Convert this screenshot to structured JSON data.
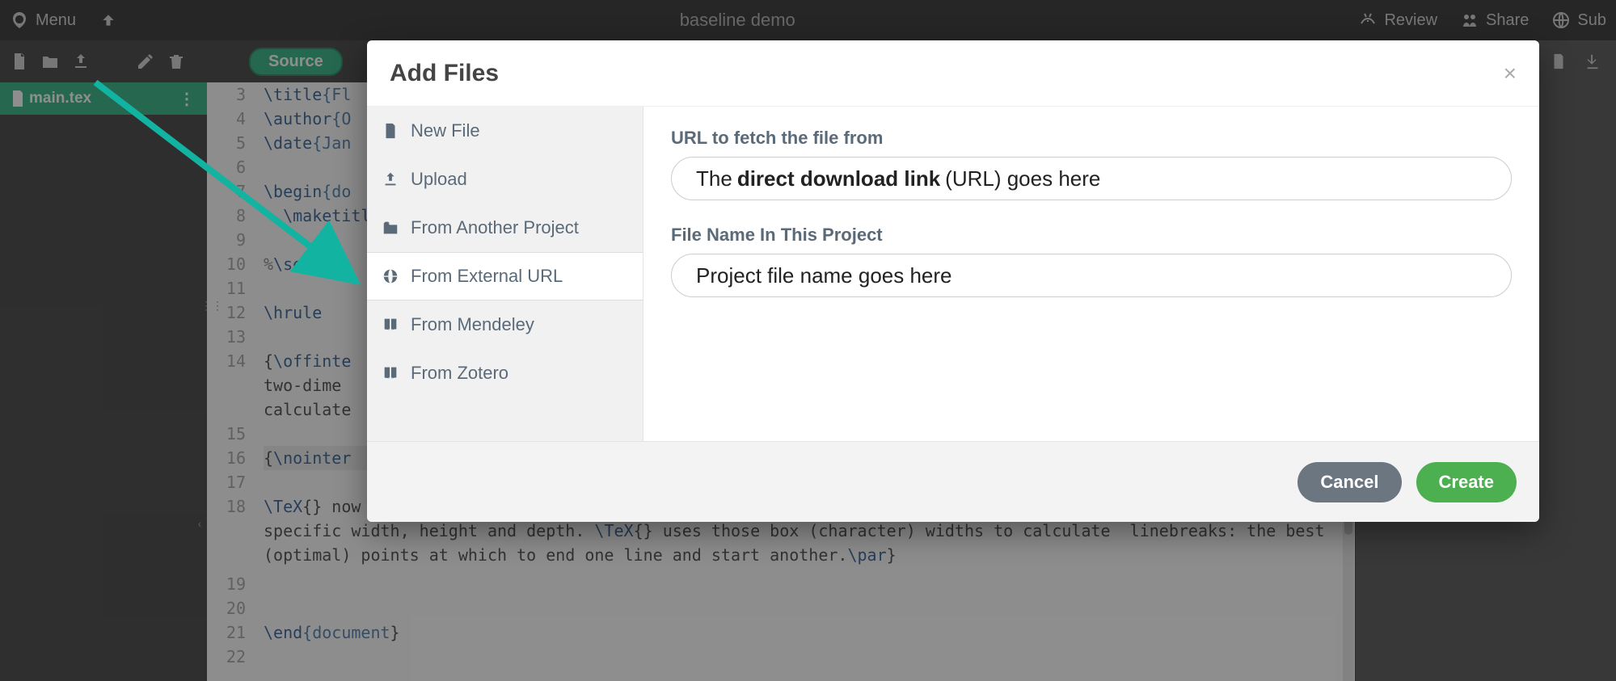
{
  "topbar": {
    "menu_label": "Menu",
    "title": "baseline demo",
    "review_label": "Review",
    "share_label": "Share",
    "submit_label": "Sub"
  },
  "toolbar": {
    "source_label": "Source"
  },
  "filetab": {
    "name": "main.tex"
  },
  "editor": {
    "lines": [
      {
        "n": 3,
        "t": "\\title{Fl"
      },
      {
        "n": 4,
        "t": "\\author{O"
      },
      {
        "n": 5,
        "t": "\\date{Jan"
      },
      {
        "n": 6,
        "t": ""
      },
      {
        "n": 7,
        "t": "\\begin{do",
        "fold": true
      },
      {
        "n": 8,
        "t": "  \\maketitl"
      },
      {
        "n": 9,
        "t": ""
      },
      {
        "n": 10,
        "t": "%\\section",
        "fold": true
      },
      {
        "n": 11,
        "t": ""
      },
      {
        "n": 12,
        "t": "\\hrule"
      },
      {
        "n": 13,
        "t": ""
      },
      {
        "n": 14,
        "t": "{\\offinte"
      },
      {
        "n": "",
        "t": "two-dime"
      },
      {
        "n": "",
        "t": "calculate"
      },
      {
        "n": 15,
        "t": ""
      },
      {
        "n": 16,
        "t": "{\\nointer",
        "hl": true
      },
      {
        "n": 17,
        "t": ""
      },
      {
        "n": 18,
        "t": "\\TeX{} now typesets a paragraph  and treats each individual character as a two-dimensional  \"box\"  with a specific width, height and depth. \\TeX{} uses those box (character) widths to calculate  linebreaks: the best (optimal) points at which to end one line and start another.\\par}"
      },
      {
        "n": 19,
        "t": ""
      },
      {
        "n": 20,
        "t": ""
      },
      {
        "n": 21,
        "t": "\\end{document}"
      },
      {
        "n": 22,
        "t": ""
      }
    ]
  },
  "modal": {
    "title": "Add Files",
    "sidebar": [
      {
        "icon": "file",
        "label": "New File"
      },
      {
        "icon": "upload",
        "label": "Upload"
      },
      {
        "icon": "folder",
        "label": "From Another Project"
      },
      {
        "icon": "globe",
        "label": "From External URL",
        "selected": true
      },
      {
        "icon": "book",
        "label": "From Mendeley"
      },
      {
        "icon": "book",
        "label": "From Zotero"
      }
    ],
    "url_label": "URL to fetch the file from",
    "url_field_prefix": "The",
    "url_field_bold": "direct download link",
    "url_field_suffix": "(URL) goes here",
    "filename_label": "File Name In This Project",
    "filename_value": "Project file name goes here",
    "cancel_label": "Cancel",
    "create_label": "Create"
  }
}
